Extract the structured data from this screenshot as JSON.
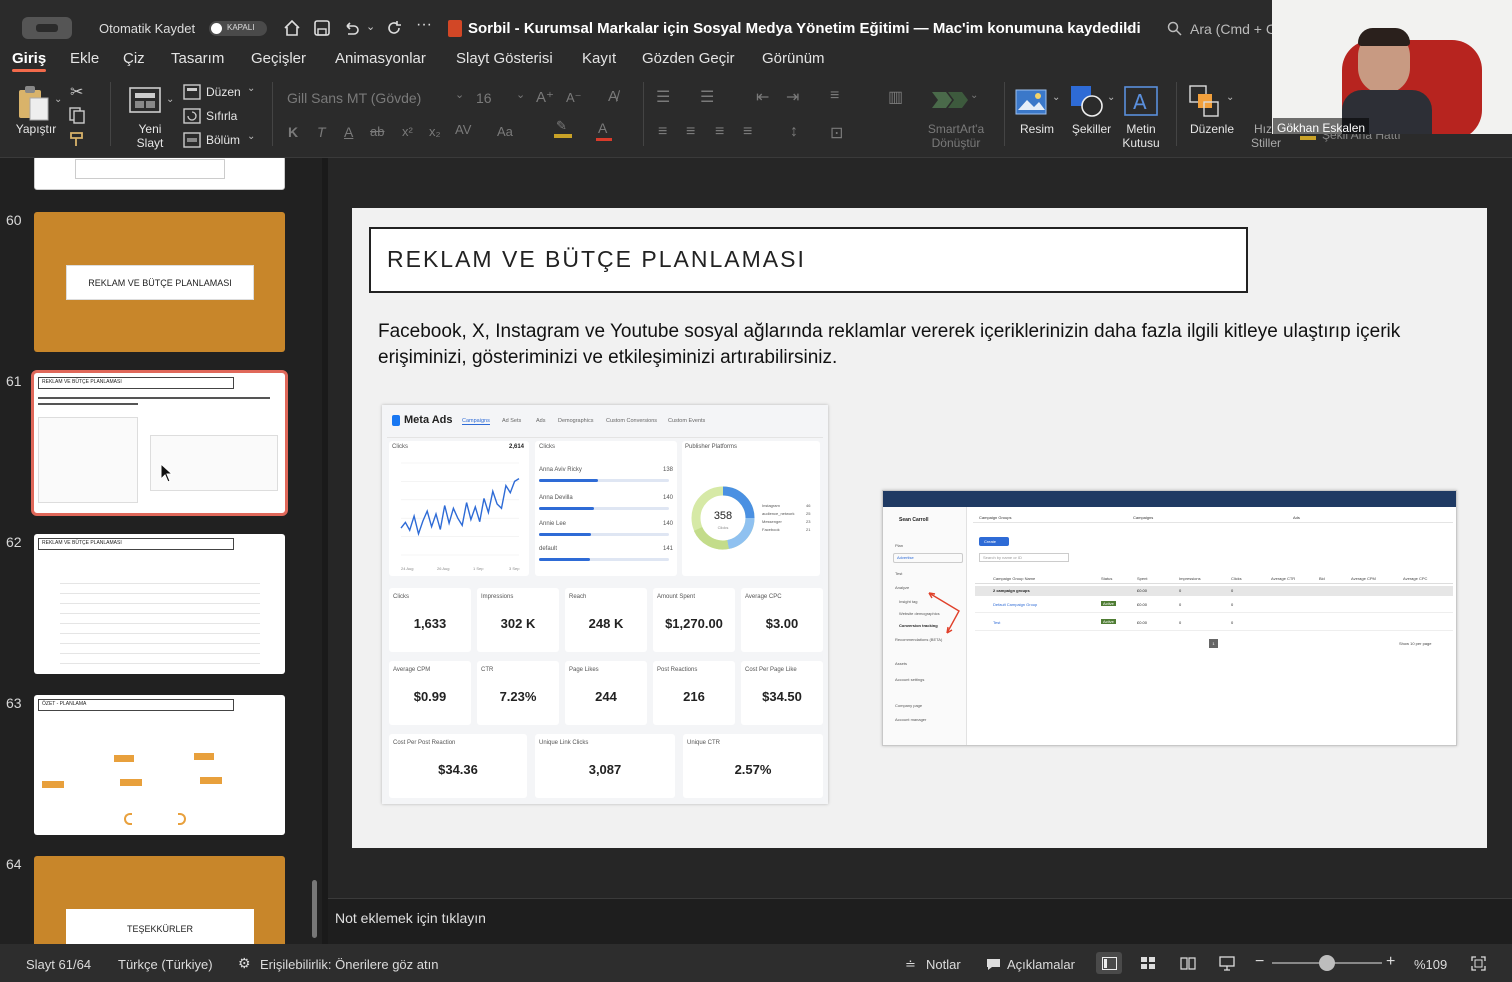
{
  "titlebar": {
    "autosave_label": "Otomatik Kaydet",
    "autosave_state": "KAPALI",
    "doc_title": "Sorbil - Kurumsal Markalar için Sosyal Medya Yönetim Eğitimi — Mac'im konumuna kaydedildi",
    "search_placeholder": "Ara (Cmd + C"
  },
  "tabs": [
    "Giriş",
    "Ekle",
    "Çiz",
    "Tasarım",
    "Geçişler",
    "Animasyonlar",
    "Slayt Gösterisi",
    "Kayıt",
    "Gözden Geçir",
    "Görünüm"
  ],
  "ribbon": {
    "paste": "Yapıştır",
    "new_slide_1": "Yeni",
    "new_slide_2": "Slayt",
    "layout": "Düzen",
    "reset": "Sıfırla",
    "section": "Bölüm",
    "font_name": "Gill Sans MT (Gövde)",
    "font_size": "16",
    "smartart_1": "SmartArt'a",
    "smartart_2": "Dönüştür",
    "picture": "Resim",
    "shapes": "Şekiller",
    "textbox_1": "Metin",
    "textbox_2": "Kutusu",
    "arrange": "Düzenle",
    "quick_1": "Hız",
    "quick_2": "Stiller",
    "outline": "Şekil Ana Hattı"
  },
  "video": {
    "name": "Gökhan Eskalen"
  },
  "thumbs": [
    {
      "num": "60",
      "title": "REKLAM VE BÜTÇE PLANLAMASI"
    },
    {
      "num": "61",
      "title": "REKLAM VE BÜTÇE PLANLAMASI"
    },
    {
      "num": "62",
      "title": "REKLAM VE BÜTÇE PLANLAMASI"
    },
    {
      "num": "63",
      "title": "ÖZET - PLANLAMA"
    },
    {
      "num": "64",
      "title": "TEŞEKKÜRLER"
    }
  ],
  "slide": {
    "title": "REKLAM VE BÜTÇE PLANLAMASI",
    "body": "Facebook, X, Instagram ve Youtube sosyal ağlarında reklamlar vererek içeriklerinizin daha fazla ilgili kitleye ulaştırıp içerik erişiminizi, gösteriminizi ve etkileşiminizi artırabilirsiniz."
  },
  "meta": {
    "brand": "Meta Ads",
    "tabs": [
      "Campaigns",
      "Ad Sets",
      "Ads",
      "Demographics",
      "Custom Conversions",
      "Custom Events"
    ],
    "clicks_label": "Clicks",
    "clicks_total": "2,614",
    "breakdown_label": "Clicks",
    "platform_label": "Publisher Platforms",
    "donut_value": "358",
    "donut_sub": "Clicks",
    "bars": [
      {
        "name": "Anna Aviv Ricky",
        "v": "138",
        "f": 0.45
      },
      {
        "name": "Anna Devilla",
        "v": "140",
        "f": 0.42
      },
      {
        "name": "Annie Lee",
        "v": "140",
        "f": 0.4
      },
      {
        "name": "default",
        "v": "141",
        "f": 0.39
      }
    ],
    "legend": [
      "Instagram",
      "audience_network",
      "Messenger",
      "Facebook"
    ],
    "legend_vals": [
      "46",
      "25",
      "23",
      "21"
    ],
    "x_ticks": [
      "24 Aug",
      "26 Aug",
      "1 Sep",
      "3 Sep"
    ],
    "metrics_row1": [
      {
        "l": "Clicks",
        "v": "1,633"
      },
      {
        "l": "Impressions",
        "v": "302 K"
      },
      {
        "l": "Reach",
        "v": "248 K"
      },
      {
        "l": "Amount Spent",
        "v": "$1,270.00"
      },
      {
        "l": "Average CPC",
        "v": "$3.00"
      }
    ],
    "metrics_row2": [
      {
        "l": "Average CPM",
        "v": "$0.99"
      },
      {
        "l": "CTR",
        "v": "7.23%"
      },
      {
        "l": "Page Likes",
        "v": "244"
      },
      {
        "l": "Post Reactions",
        "v": "216"
      },
      {
        "l": "Cost Per Page Like",
        "v": "$34.50"
      }
    ],
    "metrics_row3": [
      {
        "l": "Cost Per Post Reaction",
        "v": "$34.36"
      },
      {
        "l": "Unique Link Clicks",
        "v": "3,087"
      },
      {
        "l": "Unique CTR",
        "v": "2.57%"
      }
    ],
    "chart_data": {
      "type": "line",
      "x": [
        1,
        2,
        3,
        4,
        5,
        6,
        7,
        8,
        9,
        10,
        11,
        12,
        13,
        14,
        15,
        16,
        17,
        18,
        19,
        20,
        21,
        22,
        23,
        24,
        25,
        26,
        27,
        28
      ],
      "values": [
        38,
        46,
        35,
        55,
        30,
        48,
        62,
        40,
        58,
        36,
        70,
        45,
        66,
        52,
        42,
        74,
        50,
        68,
        47,
        80,
        60,
        90,
        72,
        66,
        98,
        88,
        104,
        108
      ],
      "ylim": [
        0,
        130
      ]
    }
  },
  "li": {
    "user": "Sean Carroll",
    "nav": [
      "Plan",
      "Advertise",
      "Test",
      "Analyze",
      "Insight tag",
      "Website demographics",
      "Conversion tracking",
      "Recommendations (BETA)",
      "Assets",
      "Account settings",
      "Company page",
      "Account manager"
    ],
    "crumbs": [
      "Campaign Groups",
      "Campaigns",
      "Ads"
    ],
    "create": "Create",
    "search_ph": "Search by name or ID",
    "cols": [
      "Campaign Group Name",
      "Status",
      "Spent",
      "Impressions",
      "Clicks",
      "Average CTR",
      "Bid",
      "Average CPM",
      "Average CPC"
    ],
    "rows": [
      {
        "name": "2 campaign groups",
        "status": "",
        "spent": "£0.00",
        "imp": "0",
        "clicks": "0"
      },
      {
        "name": "Default Campaign Group",
        "status": "Active",
        "spent": "£0.00",
        "imp": "0",
        "clicks": "0"
      },
      {
        "name": "Test",
        "status": "Active",
        "spent": "£0.00",
        "imp": "0",
        "clicks": "0"
      }
    ],
    "page": "1",
    "per_page": "Show 10 per page"
  },
  "notes": "Not eklemek için tıklayın",
  "status": {
    "slide": "Slayt 61/64",
    "lang": "Türkçe (Türkiye)",
    "access": "Erişilebilirlik: Önerilere göz atın",
    "notes": "Notlar",
    "comments": "Açıklamalar",
    "zoom": "%109"
  },
  "colors": {
    "accent": "#f26a4b",
    "thumb_orange": "#c8862a",
    "meta_blue": "#2e6bd6",
    "li_navy": "#1f3a63"
  }
}
